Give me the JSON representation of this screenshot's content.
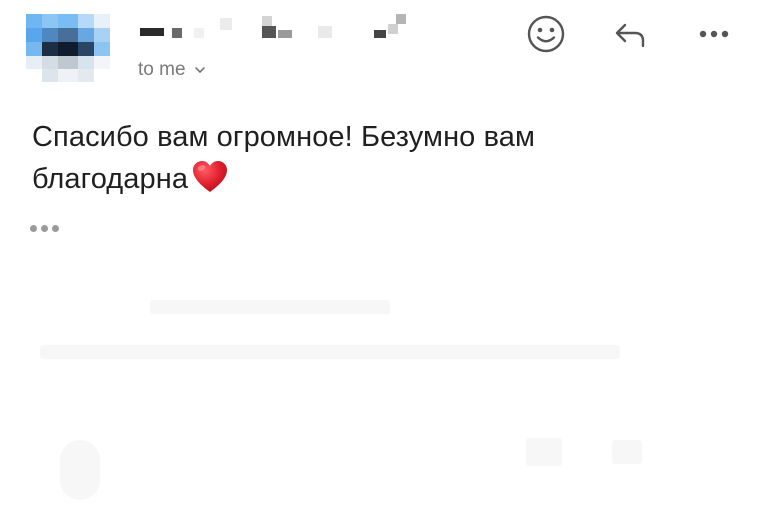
{
  "message": {
    "recipient_label": "to me",
    "body_lines": [
      "Спасибо вам огромное! Безумно вам",
      "благодарна"
    ],
    "heart_emoji": "red-heart"
  },
  "toolbar": {
    "icons": [
      "smiley-icon",
      "reply-icon",
      "more-options-icon"
    ]
  },
  "colors": {
    "text": "#1f1f1f",
    "secondary_text": "#7a7a7a",
    "icon": "#555555",
    "heart": "#e0202e"
  }
}
